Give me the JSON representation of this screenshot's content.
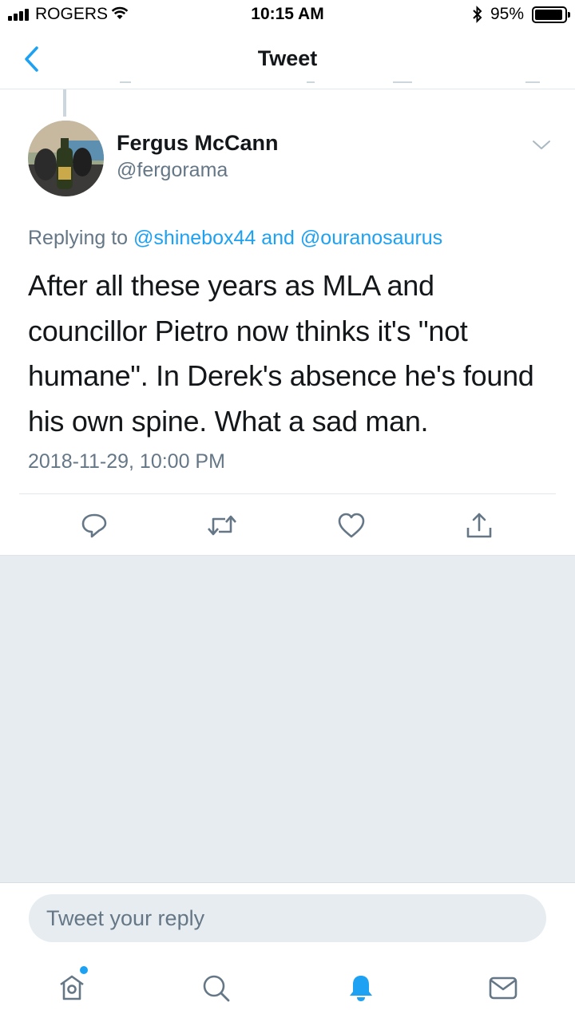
{
  "status_bar": {
    "carrier": "ROGERS",
    "time": "10:15 AM",
    "battery_percent": "95%",
    "battery_level": 0.95
  },
  "nav": {
    "title": "Tweet"
  },
  "tweet": {
    "author_name": "Fergus McCann",
    "author_handle": "@fergorama",
    "replying_prefix": "Replying to",
    "replying_mention_1": "@shinebox44",
    "replying_conjunction": "and",
    "replying_mention_2": "@ouranosaurus",
    "text": "After all these years as MLA and councillor Pietro now thinks it's \"not humane\". In Derek's absence he's found his own spine. What a sad man.",
    "timestamp": "2018-11-29, 10:00 PM"
  },
  "actions": {
    "icons": [
      "reply-icon",
      "retweet-icon",
      "like-icon",
      "share-icon"
    ]
  },
  "reply": {
    "placeholder": "Tweet your reply"
  },
  "tab_bar": {
    "icons": [
      "home-icon",
      "search-icon",
      "notifications-icon",
      "messages-icon"
    ],
    "active": "notifications-icon"
  },
  "colors": {
    "accent": "#1da1f2",
    "secondary_text": "#657786",
    "background_gray": "#e6ecf0"
  }
}
